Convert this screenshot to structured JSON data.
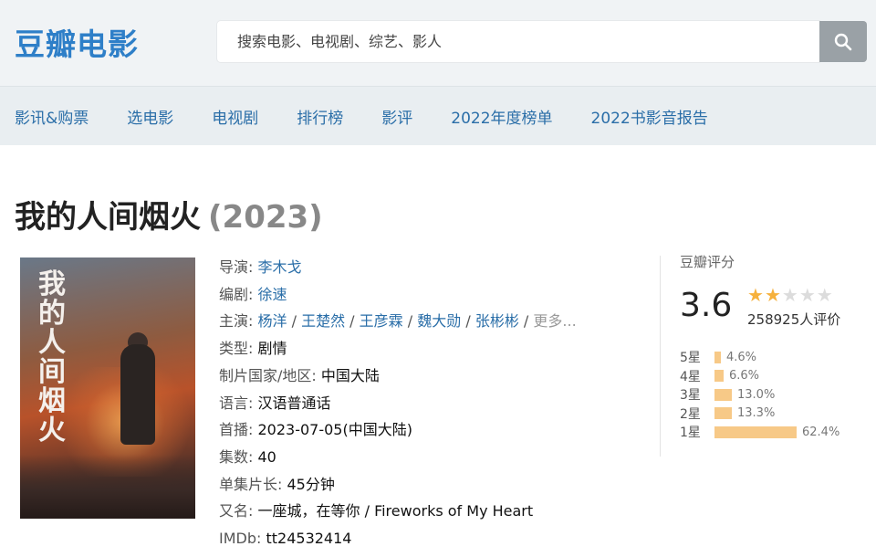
{
  "header": {
    "logo": "豆瓣电影",
    "search_placeholder": "搜索电影、电视剧、综艺、影人"
  },
  "nav": [
    "影讯&购票",
    "选电影",
    "电视剧",
    "排行榜",
    "影评",
    "2022年度榜单",
    "2022书影音报告"
  ],
  "movie": {
    "title": "我的人间烟火",
    "year": "(2023)",
    "poster_title": "我的人间烟火"
  },
  "info": {
    "director_label": "导演:",
    "director": "李木戈",
    "writer_label": "编剧:",
    "writer": "徐速",
    "cast_label": "主演:",
    "cast": [
      "杨洋",
      "王楚然",
      "王彦霖",
      "魏大勋",
      "张彬彬"
    ],
    "cast_more": "更多...",
    "genre_label": "类型:",
    "genre": "剧情",
    "country_label": "制片国家/地区:",
    "country": "中国大陆",
    "language_label": "语言:",
    "language": "汉语普通话",
    "premiere_label": "首播:",
    "premiere": "2023-07-05(中国大陆)",
    "episodes_label": "集数:",
    "episodes": "40",
    "duration_label": "单集片长:",
    "duration": "45分钟",
    "aka_label": "又名:",
    "aka": "一座城，在等你 / Fireworks of My Heart",
    "imdb_label": "IMDb:",
    "imdb": "tt24532414"
  },
  "rating": {
    "label": "豆瓣评分",
    "score": "3.6",
    "stars_filled": 2,
    "stars_total": 5,
    "votes": "258925人评价",
    "distribution": [
      {
        "label": "5星",
        "percent": 4.6,
        "text": "4.6%"
      },
      {
        "label": "4星",
        "percent": 6.6,
        "text": "6.6%"
      },
      {
        "label": "3星",
        "percent": 13.0,
        "text": "13.0%"
      },
      {
        "label": "2星",
        "percent": 13.3,
        "text": "13.3%"
      },
      {
        "label": "1星",
        "percent": 62.4,
        "text": "62.4%"
      }
    ]
  },
  "colors": {
    "link": "#2a6ea8",
    "logo": "#2e7fc8",
    "star": "#f6b13d",
    "bar": "#f7c987"
  }
}
